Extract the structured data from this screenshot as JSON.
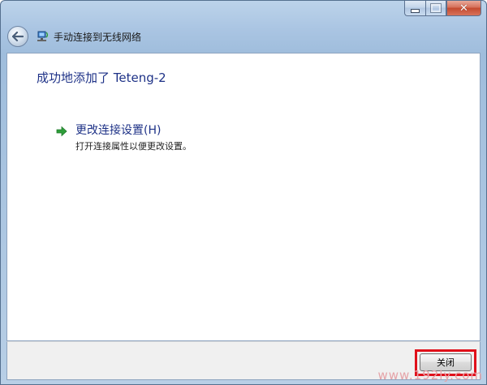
{
  "window": {
    "title": "手动连接到无线网络",
    "close_glyph": "✕"
  },
  "content": {
    "headline": "成功地添加了 Teteng-2",
    "task": {
      "title": "更改连接设置(H)",
      "description": "打开连接属性以便更改设置。"
    }
  },
  "footer": {
    "close_label": "关闭"
  },
  "watermark": "www.192ly.com",
  "colors": {
    "link_blue": "#1e3287",
    "arrow_green": "#2e9e3a",
    "highlight_red": "#e0101a"
  }
}
